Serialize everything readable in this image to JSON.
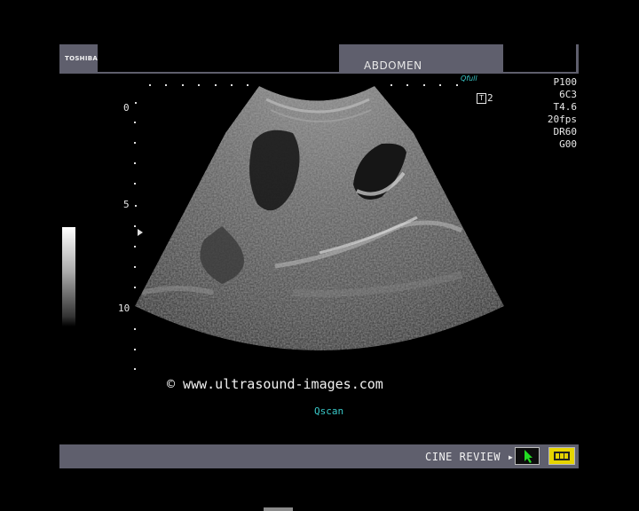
{
  "header": {
    "brand": "TOSHIBA",
    "exam": "ABDOMEN",
    "probe_indicator": "Qfull"
  },
  "params": [
    "P100",
    "6C3",
    "T4.6",
    "20fps",
    "DR60",
    "G00"
  ],
  "focus_number": "2",
  "depth_labels": [
    "0",
    "5",
    "10"
  ],
  "watermark": "© www.ultrasound-images.com",
  "scan_mode": "Qscan",
  "footer": {
    "cine_label": "CINE REVIEW ▸"
  },
  "colors": {
    "bar": "#5f5f6d",
    "accent_cyan": "#39c9c9",
    "button_yellow": "#e6d400",
    "cursor_green": "#22dd22"
  },
  "icons": {
    "cursor": "arrow-cursor-icon",
    "film": "film-strip-icon",
    "focus": "t-box-icon"
  }
}
